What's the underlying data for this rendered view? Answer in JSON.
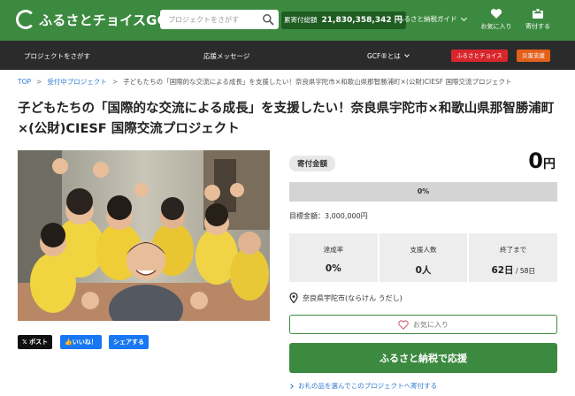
{
  "header": {
    "logo_text": "ふるさとチョイスGCF",
    "search_placeholder": "プロジェクトをさがす",
    "total_label": "累寄付総額",
    "total_value": "21,830,358,342 円",
    "guide_label": "ふるさと納税ガイド",
    "favorites_label": "お気に入り",
    "donations_label": "寄付する"
  },
  "nav": {
    "items": [
      "プロジェクトをさがす",
      "応援メッセージ",
      "GCF®とは"
    ],
    "tag_choice": "ふるさとチョイス",
    "tag_disaster": "災害支援",
    "colors": {
      "choice": "#d9262c",
      "disaster": "#e35f1c"
    }
  },
  "breadcrumb": {
    "top": "TOP",
    "category": "受付中プロジェクト",
    "current": "子どもたちの「国際的な交流による成長」を支援したい！奈良県宇陀市×和歌山県那智勝浦町×(公財)CIESF 国際交流プロジェクト"
  },
  "project": {
    "title": "子どもたちの「国際的な交流による成長」を支援したい！奈良県宇陀市×和歌山県那智勝浦町×(公財)CIESF 国際交流プロジェクト",
    "amount_label": "寄付金額",
    "amount": "0",
    "amount_unit": "円",
    "progress_percent": 0,
    "progress_label": "0%",
    "goal": "目標金額：3,000,000円",
    "stats": [
      {
        "label": "達成率",
        "value": "0%",
        "sub": ""
      },
      {
        "label": "支援人数",
        "value": "0人",
        "sub": ""
      },
      {
        "label": "終了まで",
        "value": "62日",
        "sub": " / 58日"
      }
    ],
    "location": "奈良県宇陀市(ならけん うだし)",
    "favorite_label": "お気に入り",
    "donate_label": "ふるさと納税で応援",
    "gift_link": "お礼の品を選んでこのプロジェクトへ寄付する"
  },
  "share": {
    "post": "ポスト",
    "like": "いいね！",
    "share": "シェアする"
  },
  "colors": {
    "brand_green": "#3c8a3f",
    "dark_green": "#1e5c22",
    "nav_bg": "#2b2b2b",
    "link_blue": "#2f7ad0",
    "x_black": "#111111",
    "facebook_blue": "#1877f2"
  }
}
